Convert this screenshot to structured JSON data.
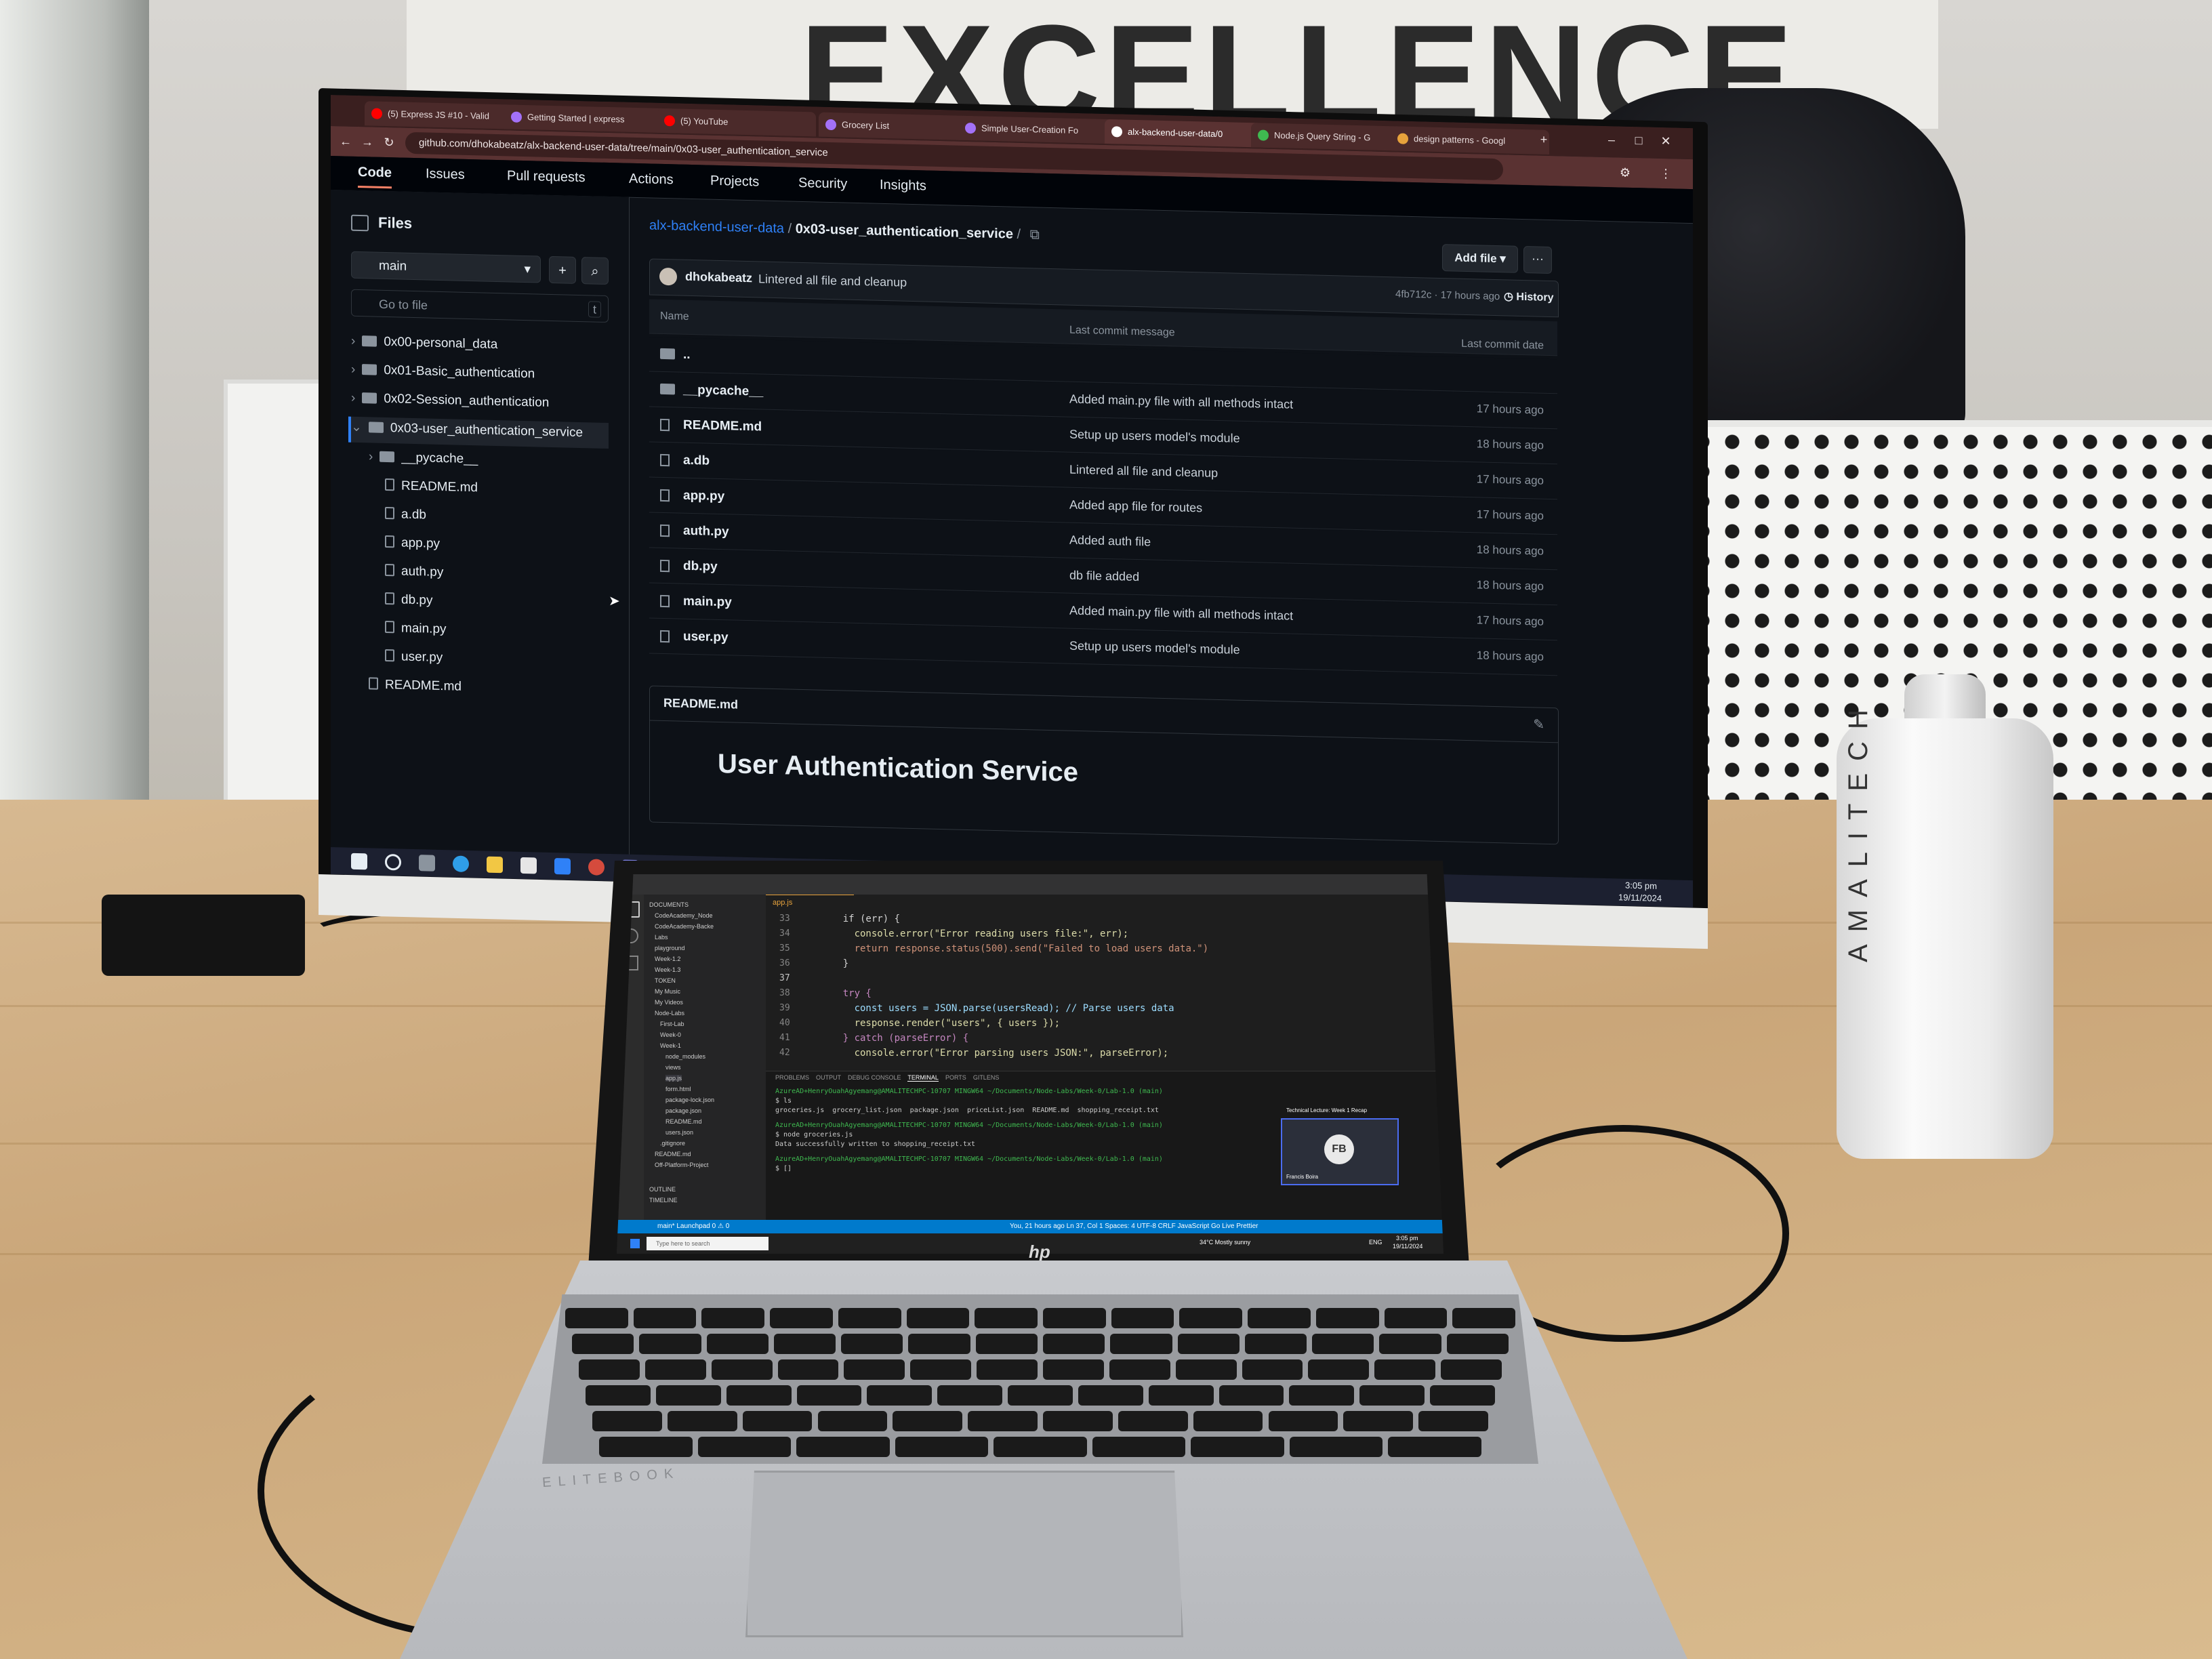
{
  "environment": {
    "sign_text": "EXCELLENCE",
    "bottle_text": "AMALITECH"
  },
  "browser": {
    "tabs": [
      {
        "label": "(5) Express JS #10 - Valid",
        "color": "#ff0000"
      },
      {
        "label": "Getting Started | express",
        "color": "#a371f7"
      },
      {
        "label": "(5) YouTube",
        "color": "#ff0000"
      },
      {
        "label": "Grocery List",
        "color": "#a371f7"
      },
      {
        "label": "Simple User-Creation Fo",
        "color": "#a371f7"
      },
      {
        "label": "alx-backend-user-data/0",
        "color": "#ffffff"
      },
      {
        "label": "Node.js Query String - G",
        "color": "#3fb950"
      },
      {
        "label": "design patterns - Googl",
        "color": "#e6a23c"
      }
    ],
    "url": "github.com/dhokabeatz/alx-backend-user-data/tree/main/0x03-user_authentication_service"
  },
  "github": {
    "nav_tabs": [
      "Code",
      "Issues",
      "Pull requests",
      "Actions",
      "Projects",
      "Security",
      "Insights"
    ],
    "sidebar": {
      "title": "Files",
      "branch": "main",
      "go_to_file_placeholder": "Go to file",
      "shortcut_key": "t",
      "tree": [
        {
          "label": "0x00-personal_data",
          "type": "folder",
          "level": 0
        },
        {
          "label": "0x01-Basic_authentication",
          "type": "folder",
          "level": 0
        },
        {
          "label": "0x02-Session_authentication",
          "type": "folder",
          "level": 0
        },
        {
          "label": "0x03-user_authentication_service",
          "type": "folder",
          "level": 0,
          "selected": true
        },
        {
          "label": "__pycache__",
          "type": "folder",
          "level": 1
        },
        {
          "label": "README.md",
          "type": "file",
          "level": 1
        },
        {
          "label": "a.db",
          "type": "file",
          "level": 1
        },
        {
          "label": "app.py",
          "type": "file",
          "level": 1
        },
        {
          "label": "auth.py",
          "type": "file",
          "level": 1
        },
        {
          "label": "db.py",
          "type": "file",
          "level": 1
        },
        {
          "label": "main.py",
          "type": "file",
          "level": 1
        },
        {
          "label": "user.py",
          "type": "file",
          "level": 1
        },
        {
          "label": "README.md",
          "type": "file",
          "level": 0
        }
      ]
    },
    "breadcrumb": {
      "repo": "alx-backend-user-data",
      "separator": "/",
      "folder": "0x03-user_authentication_service",
      "trailing": "/"
    },
    "add_file_label": "Add file",
    "more_label": "···",
    "latest_commit": {
      "author": "dhokabeatz",
      "message": "Lintered all file and cleanup",
      "meta": "4fb712c · 17 hours ago",
      "history_label": "History"
    },
    "table": {
      "headers": {
        "name": "Name",
        "message": "Last commit message",
        "date": "Last commit date"
      },
      "parent_row": "..",
      "rows": [
        {
          "name": "__pycache__",
          "type": "folder",
          "message": "Added main.py file with all methods intact",
          "date": "17 hours ago"
        },
        {
          "name": "README.md",
          "type": "file",
          "message": "Setup up users model's module",
          "date": "18 hours ago"
        },
        {
          "name": "a.db",
          "type": "file",
          "message": "Lintered all file and cleanup",
          "date": "17 hours ago"
        },
        {
          "name": "app.py",
          "type": "file",
          "message": "Added app file for routes",
          "date": "17 hours ago"
        },
        {
          "name": "auth.py",
          "type": "file",
          "message": "Added auth file",
          "date": "18 hours ago"
        },
        {
          "name": "db.py",
          "type": "file",
          "message": "db file added",
          "date": "18 hours ago"
        },
        {
          "name": "main.py",
          "type": "file",
          "message": "Added main.py file with all methods intact",
          "date": "17 hours ago"
        },
        {
          "name": "user.py",
          "type": "file",
          "message": "Setup up users model's module",
          "date": "18 hours ago"
        }
      ]
    },
    "readme": {
      "filename": "README.md",
      "heading": "User Authentication Service"
    }
  },
  "monitor_taskbar": {
    "time": "3:05 pm",
    "date": "19/11/2024"
  },
  "laptop": {
    "explorer": [
      "DOCUMENTS",
      "CodeAcademy_Node",
      "CodeAcademy-Backe",
      "Labs",
      "playground",
      "Week-1.2",
      "Week-1.3",
      "TOKEN",
      "My Music",
      "My Videos",
      "Node-Labs",
      "First-Lab",
      "Week-0",
      "Week-1",
      "node_modules",
      "views",
      "app.js",
      "form.html",
      "package-lock.json",
      "package.json",
      "README.md",
      "users.json",
      ".gitignore",
      "README.md",
      "Off-Platform-Project",
      "OUTLINE",
      "TIMELINE"
    ],
    "editor_tab": "app.js",
    "code_lines": [
      {
        "n": "33",
        "text": "    if (err) {"
      },
      {
        "n": "34",
        "text": "      console.error(\"Error reading users file:\", err);"
      },
      {
        "n": "35",
        "text": "      return response.status(500).send(\"Failed to load users data.\")"
      },
      {
        "n": "36",
        "text": "    }"
      },
      {
        "n": "37",
        "text": ""
      },
      {
        "n": "38",
        "text": "    try {"
      },
      {
        "n": "39",
        "text": "      const users = JSON.parse(usersRead); // Parse users data"
      },
      {
        "n": "40",
        "text": "      response.render(\"users\", { users });"
      },
      {
        "n": "41",
        "text": "    } catch (parseError) {"
      },
      {
        "n": "42",
        "text": "      console.error(\"Error parsing users JSON:\", parseError);"
      }
    ],
    "panel_tabs": [
      "PROBLEMS",
      "OUTPUT",
      "DEBUG CONSOLE",
      "TERMINAL",
      "PORTS",
      "GITLENS"
    ],
    "terminal_lines": [
      "AzureAD+HenryOuahAgyemang@AMALITECHPC-10707 MINGW64 ~/Documents/Node-Labs/Week-0/Lab-1.0 (main)",
      "$ ls",
      "groceries.js  grocery_list.json  package.json  priceList.json  README.md  shopping_receipt.txt",
      "AzureAD+HenryOuahAgyemang@AMALITECHPC-10707 MINGW64 ~/Documents/Node-Labs/Week-0/Lab-1.0 (main)",
      "$ node groceries.js",
      "Data successfully written to shopping_receipt.txt",
      "AzureAD+HenryOuahAgyemang@AMALITECHPC-10707 MINGW64 ~/Documents/Node-Labs/Week-0/Lab-1.0 (main)",
      "$ []"
    ],
    "status_left": "main*   Launchpad   0 ⚠ 0",
    "status_right": "You, 21 hours ago   Ln 37, Col 1   Spaces: 4   UTF-8   CRLF   JavaScript   Go Live   Prettier",
    "meet_title": "Technical Lecture: Week 1 Recap",
    "meet_initials": "FB",
    "meet_name": "Francis Boira",
    "search_placeholder": "Type here to search",
    "weather": "34°C  Mostly sunny",
    "lang": "ENG",
    "time": "3:05 pm",
    "date": "19/11/2024",
    "brand": "hp",
    "model": "ELITEBOOK"
  }
}
